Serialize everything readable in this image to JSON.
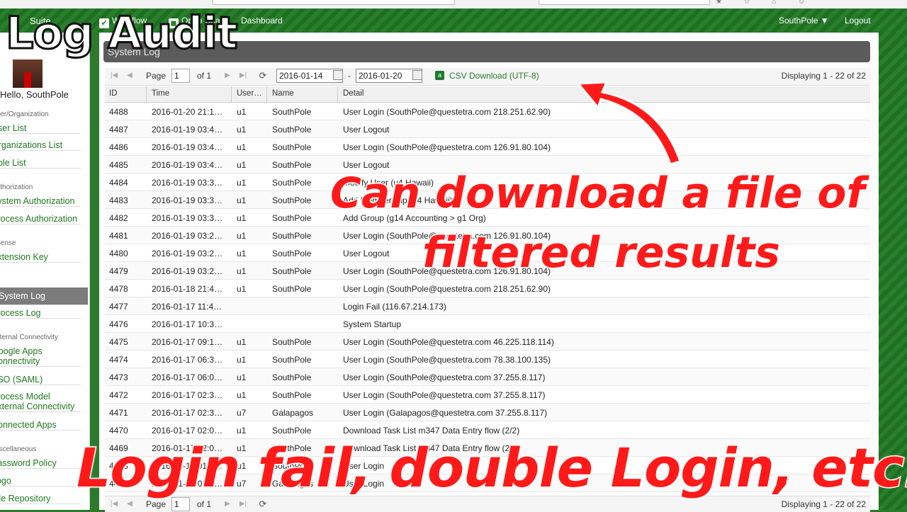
{
  "topbar": {
    "brand": "Suite",
    "nav": [
      "Workflow",
      "Open Chat",
      "Dashboard"
    ],
    "user": "SouthPole",
    "logout": "Logout"
  },
  "sidebar": {
    "hello": "Hello, SouthPole",
    "sections": [
      {
        "head": "User/Organization",
        "items": [
          "User List",
          "Organizations List",
          "Role List"
        ]
      },
      {
        "head": "Authorization",
        "items": [
          "System Authorization",
          "Process Authorization"
        ]
      },
      {
        "head": "License",
        "items": [
          "Extension Key"
        ]
      },
      {
        "head": "",
        "items": [
          "System Log",
          "Process Log"
        ]
      },
      {
        "head": "External Connectivity",
        "items": [
          "Google Apps Connectivity",
          "SSO (SAML)",
          "Process Model External Connectivity",
          "Connected Apps"
        ]
      },
      {
        "head": "Miscellaneous",
        "items": [
          "Password Policy",
          "Logo",
          "File Repository"
        ]
      }
    ]
  },
  "panel": {
    "title": "System Log"
  },
  "toolbar": {
    "page_label": "Page",
    "page_value": "1",
    "of_label": "of 1",
    "date_from": "2016-01-14",
    "date_to": "2016-01-20",
    "dash": "-",
    "csv_icon": "a",
    "csv_label": "CSV Download (UTF-8)",
    "displaying": "Displaying 1 - 22 of 22"
  },
  "columns": [
    "ID",
    "Time",
    "User…",
    "Name",
    "Detail"
  ],
  "rows": [
    [
      "4488",
      "2016-01-20 21:1…",
      "u1",
      "SouthPole",
      "User Login (SouthPole@questetra.com 218.251.62.90)"
    ],
    [
      "4487",
      "2016-01-19 03:4…",
      "u1",
      "SouthPole",
      "User Logout"
    ],
    [
      "4486",
      "2016-01-19 03:4…",
      "u1",
      "SouthPole",
      "User Login (SouthPole@questetra.com 126.91.80.104)"
    ],
    [
      "4485",
      "2016-01-19 03:4…",
      "u1",
      "SouthPole",
      "User Logout"
    ],
    [
      "4484",
      "2016-01-19 03:3…",
      "u1",
      "SouthPole",
      "Modify User (u4 Hawaii)"
    ],
    [
      "4483",
      "2016-01-19 03:3…",
      "u1",
      "SouthPole",
      "Add Membership (u4 Hawaii)"
    ],
    [
      "4482",
      "2016-01-19 03:3…",
      "u1",
      "SouthPole",
      "Add Group (g14 Accounting > g1 Org)"
    ],
    [
      "4481",
      "2016-01-19 03:2…",
      "u1",
      "SouthPole",
      "User Login (SouthPole@questetra.com 126.91.80.104)"
    ],
    [
      "4480",
      "2016-01-19 03:2…",
      "u1",
      "SouthPole",
      "User Logout"
    ],
    [
      "4479",
      "2016-01-19 03:2…",
      "u1",
      "SouthPole",
      "User Login (SouthPole@questetra.com 126.91.80.104)"
    ],
    [
      "4478",
      "2016-01-18 21:4…",
      "u1",
      "SouthPole",
      "User Login (SouthPole@questetra.com 218.251.62.90)"
    ],
    [
      "4477",
      "2016-01-17 11:4…",
      "",
      "",
      "Login Fail (116.67.214.173)"
    ],
    [
      "4476",
      "2016-01-17 10:3…",
      "",
      "",
      "System Startup"
    ],
    [
      "4475",
      "2016-01-17 09:1…",
      "u1",
      "SouthPole",
      "User Login (SouthPole@questetra.com 46.225.118.114)"
    ],
    [
      "4474",
      "2016-01-17 06:3…",
      "u1",
      "SouthPole",
      "User Login (SouthPole@questetra.com 78.38.100.135)"
    ],
    [
      "4473",
      "2016-01-17 06:0…",
      "u1",
      "SouthPole",
      "User Login (SouthPole@questetra.com 37.255.8.117)"
    ],
    [
      "4472",
      "2016-01-17 02:3…",
      "u1",
      "SouthPole",
      "User Login (SouthPole@questetra.com 37.255.8.117)"
    ],
    [
      "4471",
      "2016-01-17 02:3…",
      "u7",
      "Galapagos",
      "User Login (Galapagos@questetra.com 37.255.8.117)"
    ],
    [
      "4470",
      "2016-01-17 02:0…",
      "u1",
      "SouthPole",
      "Download Task List m347 Data Entry flow (2/2)"
    ],
    [
      "4469",
      "2016-01-17 02:0…",
      "u1",
      "SouthPole",
      "Download Task List m347 Data Entry flow (2/2)"
    ],
    [
      "4468",
      "2016-01-17 01:5…",
      "u1",
      "SouthPole",
      "User Login"
    ],
    [
      "4467",
      "2016-01-17 01:5…",
      "u7",
      "Galapagos",
      "User Login"
    ]
  ],
  "overlay": {
    "title": "Log Audit",
    "caption1": "Can download a file of",
    "caption2": "filtered results",
    "caption3": "Login fail, double Login, etc."
  }
}
